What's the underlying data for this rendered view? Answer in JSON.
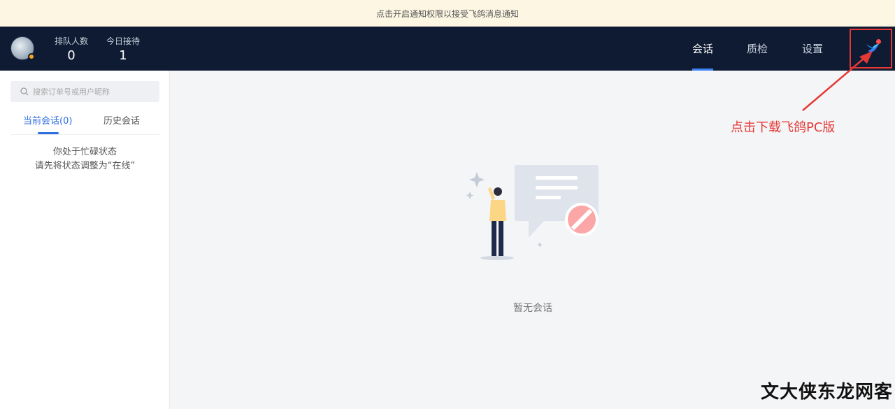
{
  "banner": {
    "text": "点击开启通知权限以接受飞鸽消息通知"
  },
  "header": {
    "stats": [
      {
        "label": "排队人数",
        "value": "0"
      },
      {
        "label": "今日接待",
        "value": "1"
      }
    ],
    "tabs": [
      {
        "label": "会话",
        "active": true
      },
      {
        "label": "质检",
        "active": false
      },
      {
        "label": "设置",
        "active": false
      }
    ],
    "app_icon": "feige-bird-icon",
    "accent_color": "#3b82f6",
    "notification_color": "#ff4d4f"
  },
  "sidebar": {
    "search": {
      "placeholder": "搜索订单号或用户昵称",
      "value": ""
    },
    "tabs": [
      {
        "label": "当前会话(0)",
        "active": true
      },
      {
        "label": "历史会话",
        "active": false
      }
    ],
    "status_message": {
      "line1": "你处于忙碌状态",
      "line2": "请先将状态调整为“在线”"
    }
  },
  "main": {
    "empty_text": "暂无会话"
  },
  "annotation": {
    "text": "点击下载飞鸽PC版",
    "color": "#e53935"
  },
  "watermark": {
    "text": "文大侠东龙网客"
  }
}
